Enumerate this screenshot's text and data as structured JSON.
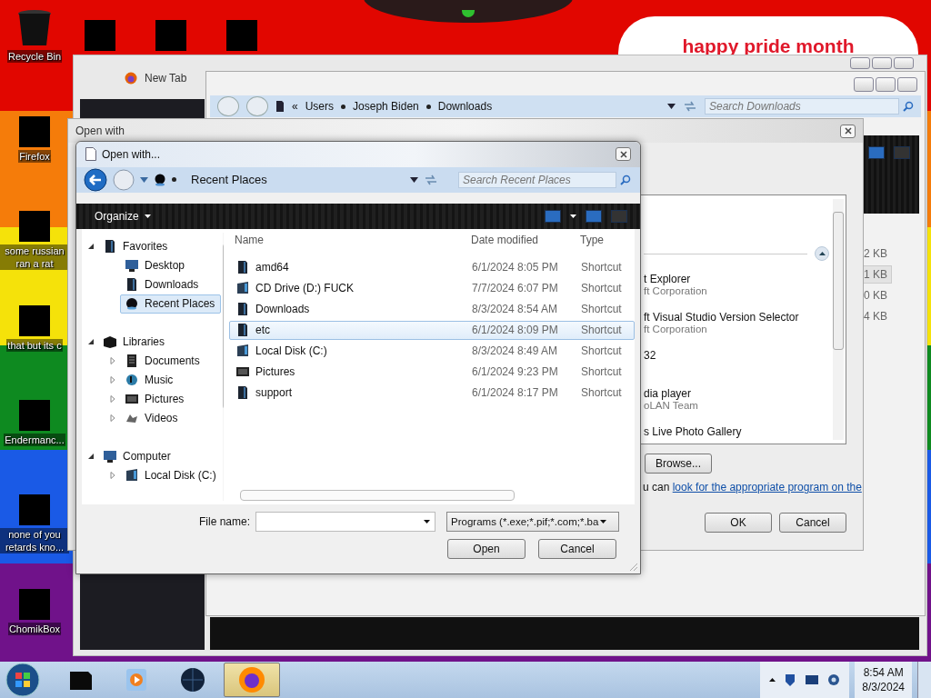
{
  "desktop": {
    "banner": "happy pride month",
    "icons": [
      {
        "label": "Recycle Bin",
        "kind": "bin"
      },
      {
        "label": "Firefox",
        "kind": "redacted"
      },
      {
        "label": "some russian ran a rat",
        "kind": "redacted"
      },
      {
        "label": "that but its c",
        "kind": "redacted"
      },
      {
        "label": "Endermanc...",
        "kind": "redacted"
      },
      {
        "label": "none of you retards kno...",
        "kind": "redacted"
      },
      {
        "label": "ChomikBox",
        "kind": "redacted"
      }
    ]
  },
  "browser": {
    "tab": "New Tab"
  },
  "explorer": {
    "prefix": "«",
    "path": [
      "Users",
      "Joseph Biden",
      "Downloads"
    ],
    "search": {
      "placeholder": "Search Downloads"
    },
    "sizes": [
      {
        "text": "2 KB",
        "selected": false
      },
      {
        "text": "1 KB",
        "selected": true
      },
      {
        "text": "0 KB",
        "selected": false
      },
      {
        "text": "4 KB",
        "selected": false
      }
    ]
  },
  "open_with": {
    "title": "Open with",
    "programs": [
      {
        "name": "t Explorer",
        "publisher": "ft Corporation"
      },
      {
        "name": "ft Visual Studio Version Selector",
        "publisher": "ft Corporation"
      },
      {
        "name": "32"
      },
      {
        "name": "dia player",
        "publisher": "oLAN Team"
      },
      {
        "name": "s Live Photo Gallery"
      }
    ],
    "browse": "Browse...",
    "hint": "u can",
    "hint_link": "look for the appropriate program on the",
    "ok": "OK",
    "cancel": "Cancel"
  },
  "file_dialog": {
    "title": "Open with...",
    "location": "Recent Places",
    "search": {
      "placeholder": "Search Recent Places"
    },
    "organize": "Organize",
    "nav": [
      {
        "label": "Favorites",
        "kind": "favorites",
        "expanded": true,
        "selected": false,
        "children": [
          {
            "label": "Desktop",
            "kind": "desktop",
            "selected": false
          },
          {
            "label": "Downloads",
            "kind": "folder",
            "selected": false
          },
          {
            "label": "Recent Places",
            "kind": "recent",
            "selected": true
          }
        ]
      },
      {
        "label": "Libraries",
        "kind": "library",
        "expanded": true,
        "selected": false,
        "children": [
          {
            "label": "Documents",
            "kind": "documents",
            "expanded": false,
            "selected": false
          },
          {
            "label": "Music",
            "kind": "music",
            "expanded": false,
            "selected": false
          },
          {
            "label": "Pictures",
            "kind": "pictures",
            "expanded": false,
            "selected": false
          },
          {
            "label": "Videos",
            "kind": "videos",
            "expanded": false,
            "selected": false
          }
        ]
      },
      {
        "label": "Computer",
        "kind": "computer",
        "expanded": true,
        "selected": false,
        "children": [
          {
            "label": "Local Disk (C:)",
            "kind": "drive",
            "expanded": false,
            "selected": false
          }
        ]
      }
    ],
    "columns": [
      "Name",
      "Date modified",
      "Type"
    ],
    "files": [
      {
        "name": "amd64",
        "date": "6/1/2024 8:05 PM",
        "type": "Shortcut",
        "kind": "folder",
        "selected": false
      },
      {
        "name": "CD Drive (D:) FUCK",
        "date": "7/7/2024 6:07 PM",
        "type": "Shortcut",
        "kind": "drive",
        "selected": false
      },
      {
        "name": "Downloads",
        "date": "8/3/2024 8:54 AM",
        "type": "Shortcut",
        "kind": "folder",
        "selected": false
      },
      {
        "name": "etc",
        "date": "6/1/2024 8:09 PM",
        "type": "Shortcut",
        "kind": "folder",
        "selected": true
      },
      {
        "name": "Local Disk (C:)",
        "date": "8/3/2024 8:49 AM",
        "type": "Shortcut",
        "kind": "drive",
        "selected": false
      },
      {
        "name": "Pictures",
        "date": "6/1/2024 9:23 PM",
        "type": "Shortcut",
        "kind": "pictures",
        "selected": false
      },
      {
        "name": "support",
        "date": "6/1/2024 8:17 PM",
        "type": "Shortcut",
        "kind": "folder",
        "selected": false
      }
    ],
    "file_name_label": "File name:",
    "filter": "Programs (*.exe;*.pif;*.com;*.ba",
    "open": "Open",
    "cancel": "Cancel"
  },
  "taskbar": {
    "items": [
      {
        "kind": "redacted",
        "selected": false
      },
      {
        "kind": "media",
        "selected": false
      },
      {
        "kind": "globe",
        "selected": false
      },
      {
        "kind": "firefox",
        "selected": true
      }
    ],
    "time": "8:54 AM",
    "date": "8/3/2024"
  }
}
